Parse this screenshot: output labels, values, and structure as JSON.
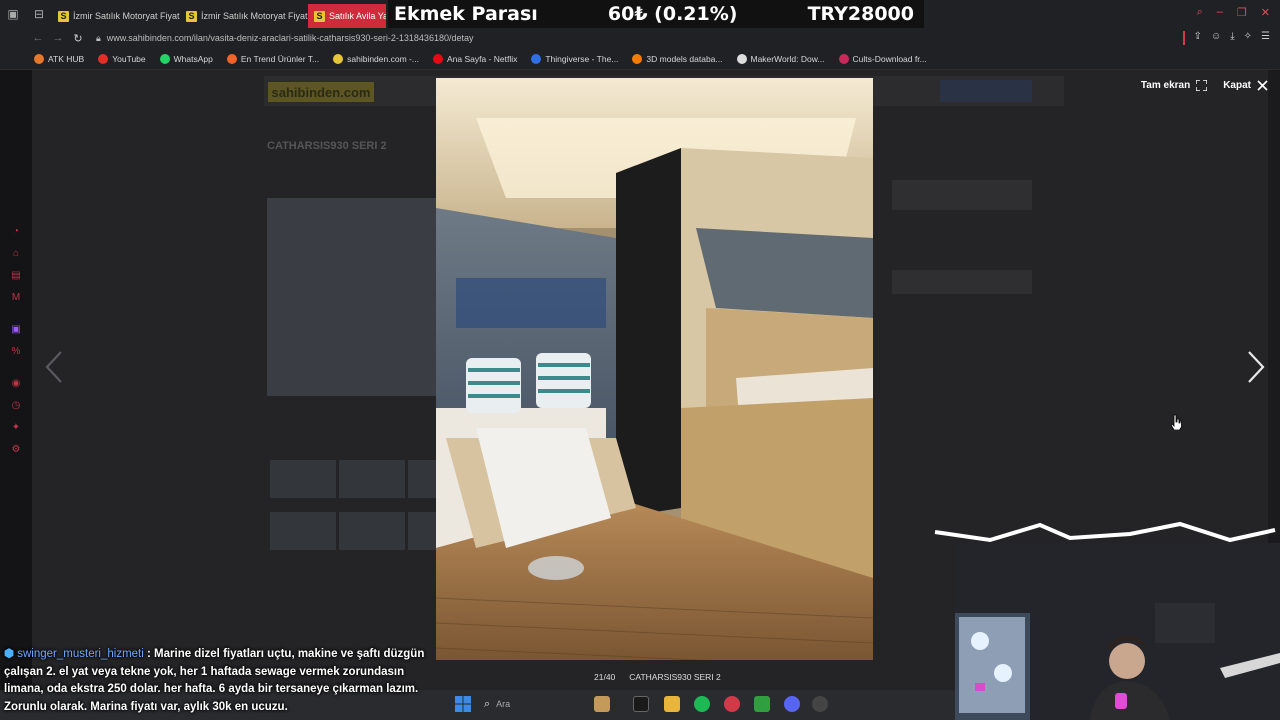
{
  "tabs": [
    {
      "label": "İzmir Satılık Motoryat Fiyatları"
    },
    {
      "label": "İzmir Satılık Motoryat Fiyatları"
    },
    {
      "label": "Satılık Avila Yacht"
    }
  ],
  "ticker": {
    "title": "Ekmek Parası",
    "change": "60₺ (0.21%)",
    "total": "TRY28000"
  },
  "address": {
    "url": "www.sahibinden.com/ilan/vasita-deniz-araclari-satilik-catharsis930-seri-2-1318436180/detay"
  },
  "bookmarks": [
    {
      "label": "ATK HUB",
      "color": "#e8772e"
    },
    {
      "label": "YouTube",
      "color": "#e52d27"
    },
    {
      "label": "WhatsApp",
      "color": "#25d366"
    },
    {
      "label": "En Trend Ürünler T...",
      "color": "#f0642a"
    },
    {
      "label": "sahibinden.com -...",
      "color": "#e6c53a"
    },
    {
      "label": "Ana Sayfa - Netflix",
      "color": "#e50914"
    },
    {
      "label": "Thingiverse - The...",
      "color": "#2f6fe6"
    },
    {
      "label": "3D models databa...",
      "color": "#f57c00"
    },
    {
      "label": "MakerWorld: Dow...",
      "color": "#dddddd"
    },
    {
      "label": "Cults-Download fr...",
      "color": "#c82a5a"
    }
  ],
  "page": {
    "logo": "sahibinden.com",
    "listing_title": "CATHARSIS930 SERI 2"
  },
  "lightbox": {
    "fullscreen_label": "Tam ekran",
    "close_label": "Kapat",
    "counter": "21/40",
    "caption": "CATHARSIS930 SERI 2"
  },
  "chat": {
    "user": "swinger_musteri_hizmeti",
    "message": "Marine dizel fiyatları uçtu, makine ve şaftı düzgün çalışan 2. el yat veya tekne yok, her 1 haftada sewage vermek zorundasın limana, oda ekstra 250 dolar. her hafta. 6 ayda bir tersaneye çıkarman lazım. Zorunlu olarak. Marina fiyatı var, aylık 30k en ucuzu."
  },
  "taskbar": {
    "search_placeholder": "Ara"
  },
  "colors": {
    "accent": "#cf2b3b",
    "brand_yellow": "#e6c53a",
    "chat_user": "#6aa6ff"
  }
}
